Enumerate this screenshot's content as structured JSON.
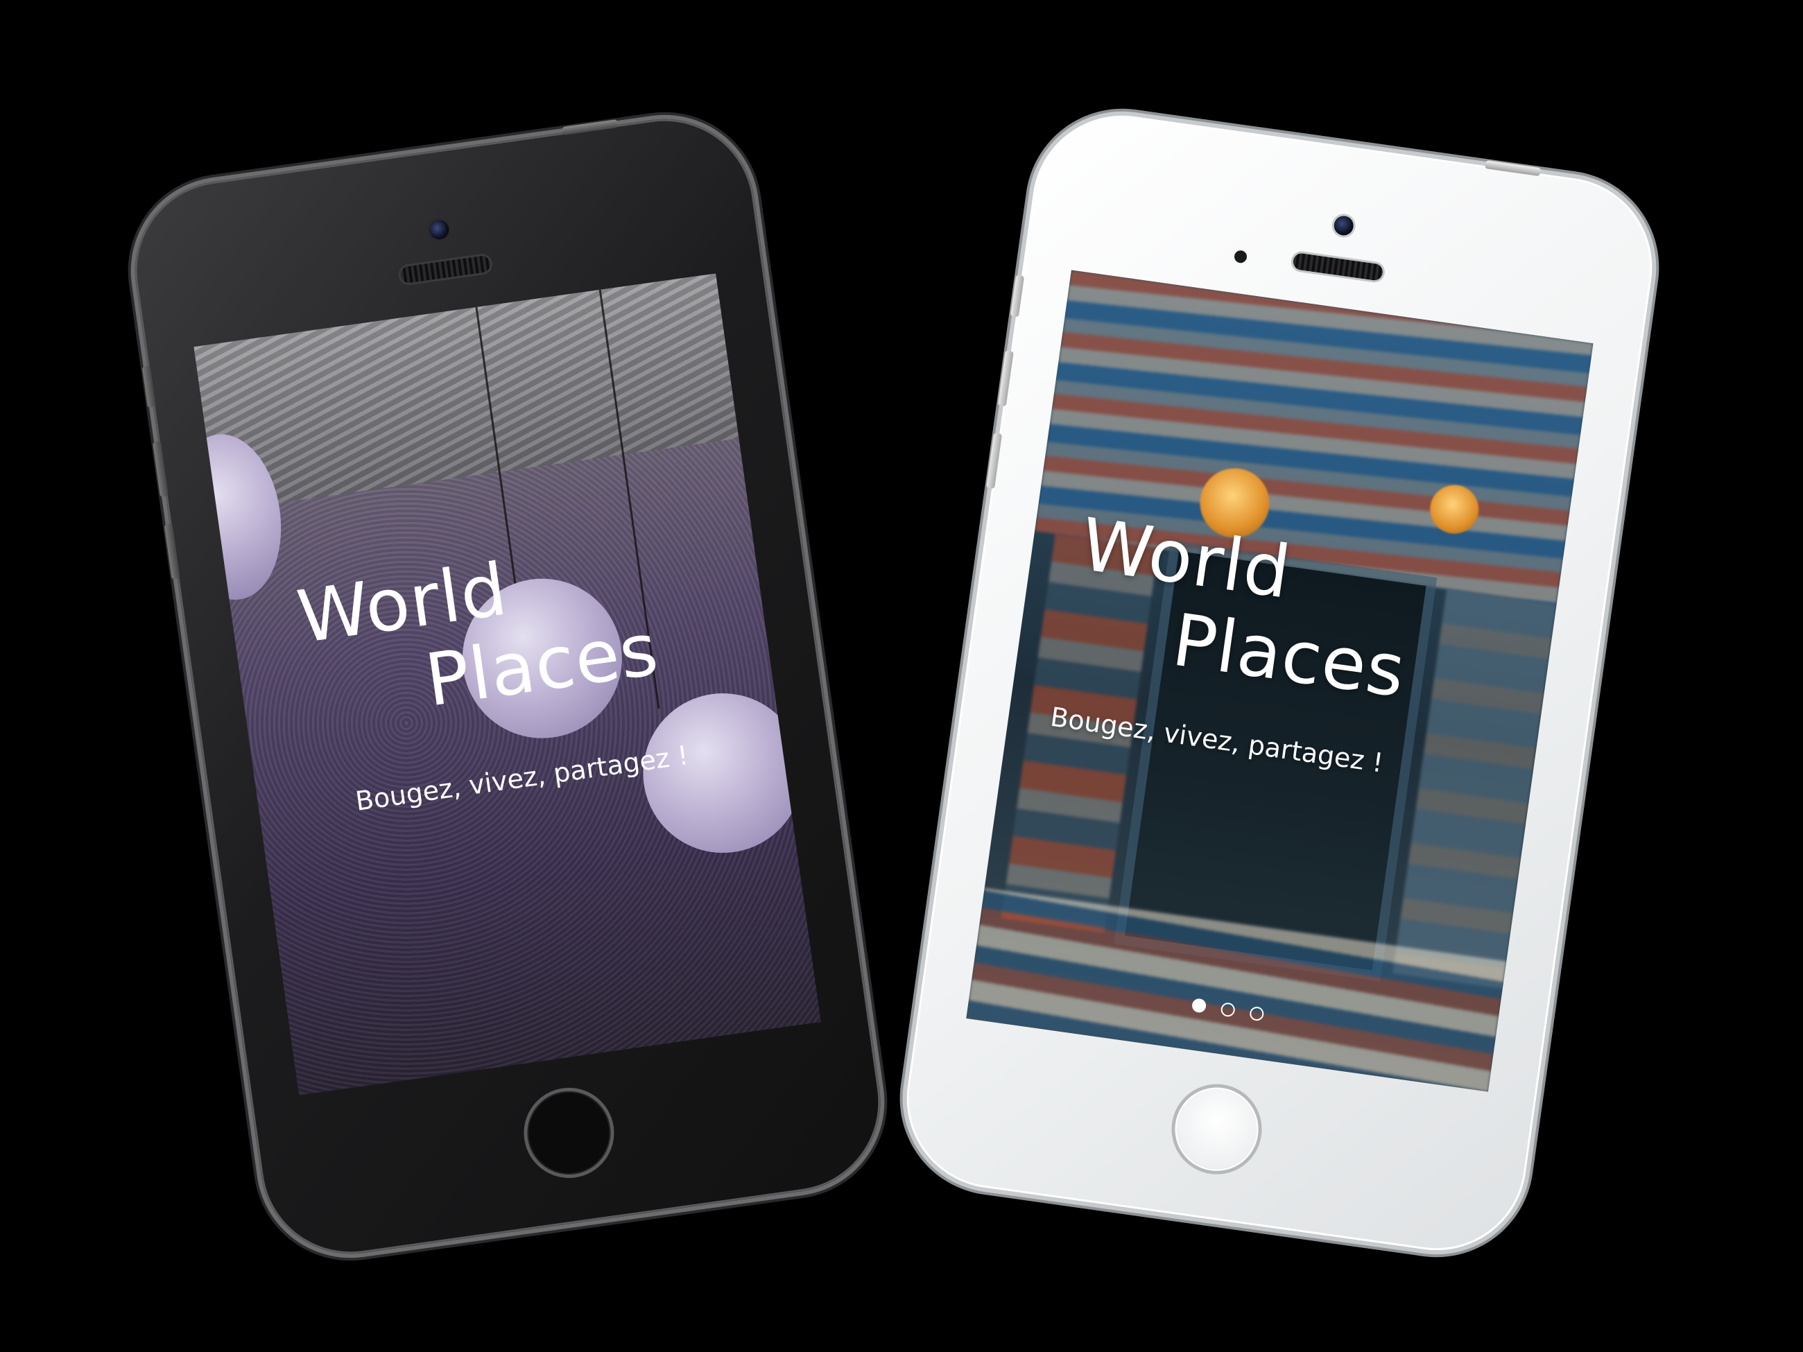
{
  "devices": [
    {
      "model": "space-gray",
      "app_title_line1": "World",
      "app_title_line2": "Places",
      "tagline": "Bougez, vivez, partagez !"
    },
    {
      "model": "silver",
      "app_title_line1": "World",
      "app_title_line2": "Places",
      "tagline": "Bougez, vivez, partagez !",
      "carousel": {
        "total": 3,
        "active_index": 0
      }
    }
  ],
  "colors": {
    "background": "#000000",
    "overlay_purple": "#54476a",
    "text": "#ffffff"
  }
}
